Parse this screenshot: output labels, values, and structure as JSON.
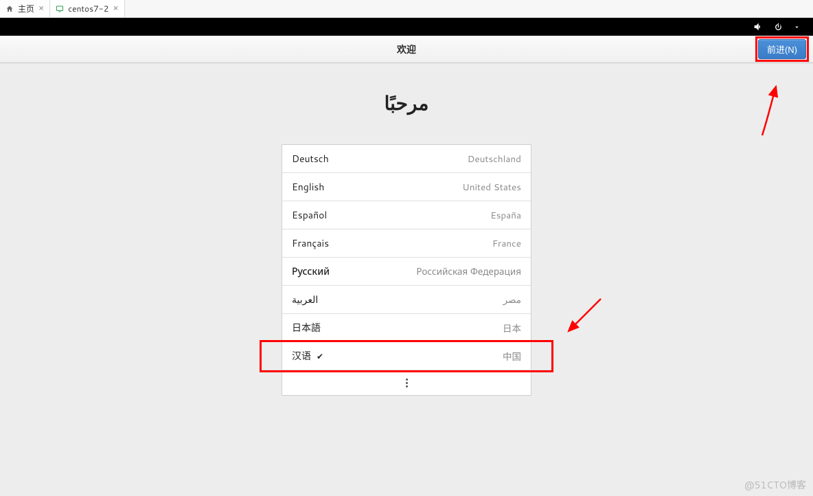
{
  "tabs": {
    "home": "主页",
    "vm": "centos7-2"
  },
  "headerbar": {
    "title": "欢迎",
    "next_button": "前进(N)"
  },
  "welcome_heading": "مرحبًا",
  "languages": [
    {
      "name": "Deutsch",
      "country": "Deutschland",
      "selected": false
    },
    {
      "name": "English",
      "country": "United States",
      "selected": false
    },
    {
      "name": "Español",
      "country": "España",
      "selected": false
    },
    {
      "name": "Français",
      "country": "France",
      "selected": false
    },
    {
      "name": "Русский",
      "country": "Российская Федерация",
      "selected": false
    },
    {
      "name": "العربية",
      "country": "مصر",
      "selected": false
    },
    {
      "name": "日本語",
      "country": "日本",
      "selected": false
    },
    {
      "name": "汉语",
      "country": "中国",
      "selected": true
    }
  ],
  "watermark": "@51CTO博客"
}
